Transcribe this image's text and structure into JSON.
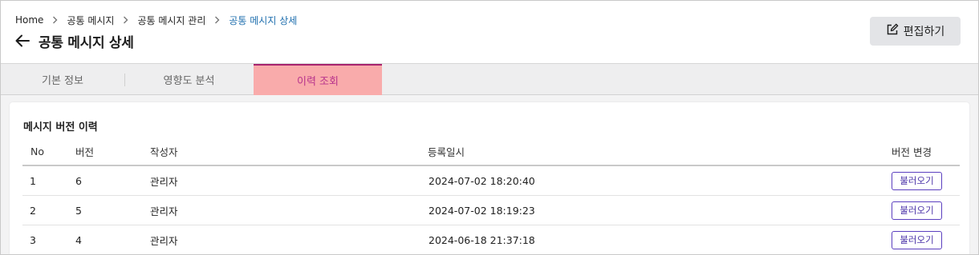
{
  "breadcrumb": {
    "items": [
      "Home",
      "공통 메시지",
      "공통 메시지 관리",
      "공통 메시지 상세"
    ]
  },
  "header": {
    "title": "공통 메시지 상세",
    "edit_label": "편집하기"
  },
  "tabs": [
    {
      "label": "기본 정보",
      "active": false
    },
    {
      "label": "영향도 분석",
      "active": false
    },
    {
      "label": "이력 조회",
      "active": true
    }
  ],
  "history": {
    "title": "메시지 버전 이력",
    "columns": [
      "No",
      "버전",
      "작성자",
      "등록일시",
      "버전 변경"
    ],
    "rows": [
      {
        "no": "1",
        "version": "6",
        "author": "관리자",
        "registered": "2024-07-02 18:20:40",
        "action": "불러오기"
      },
      {
        "no": "2",
        "version": "5",
        "author": "관리자",
        "registered": "2024-07-02 18:19:23",
        "action": "불러오기"
      },
      {
        "no": "3",
        "version": "4",
        "author": "관리자",
        "registered": "2024-06-18 21:37:18",
        "action": "불러오기"
      }
    ]
  },
  "colors": {
    "active_tab_bg": "#f9abab",
    "active_tab_text": "#b7338c",
    "breadcrumb_active": "#1f6fae",
    "button_border": "#5b3fbf"
  }
}
